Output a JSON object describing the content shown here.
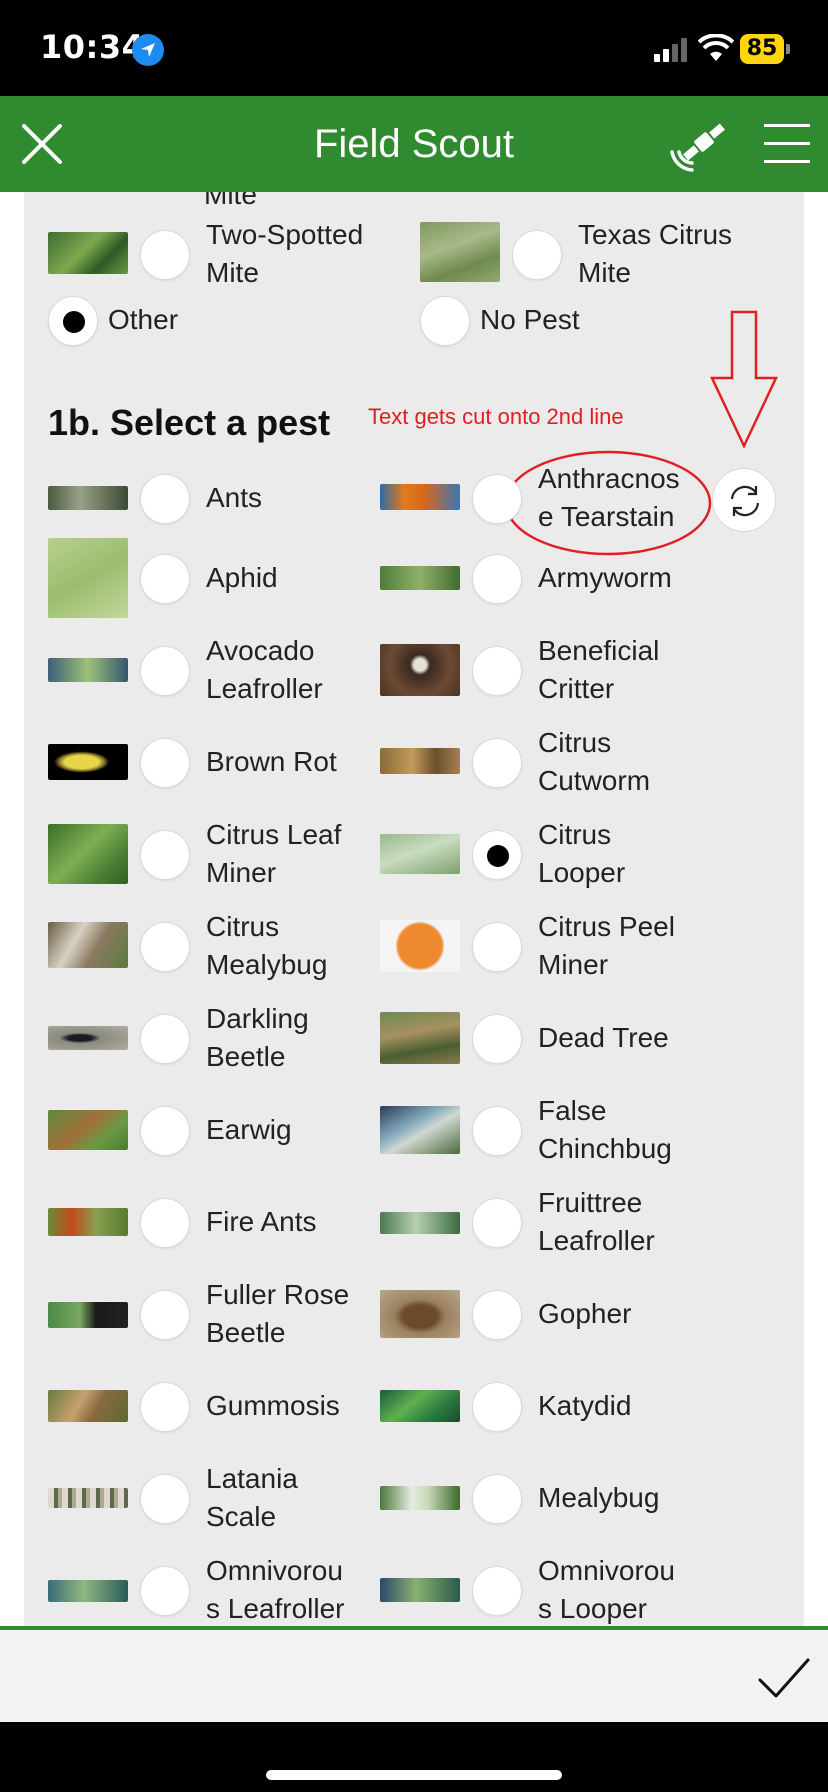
{
  "status_bar": {
    "time": "10:34",
    "battery_level": "85",
    "location_icon": "location-arrow-icon",
    "signal_icon": "cellular-signal-icon",
    "wifi_icon": "wifi-icon",
    "battery_icon": "battery-icon"
  },
  "header": {
    "title": "Field Scout",
    "close_icon": "close-icon",
    "gps_icon": "satellite-gps-icon",
    "menu_icon": "hamburger-menu-icon",
    "background_color": "#2f8a30"
  },
  "section_1a": {
    "clipped_labels": [
      "Mite",
      ""
    ],
    "options": [
      {
        "label_lines": [
          "Two-Spotted",
          "Mite"
        ],
        "checked": false,
        "has_image": true
      },
      {
        "label_lines": [
          "Texas Citrus",
          "Mite"
        ],
        "checked": false,
        "has_image": true
      },
      {
        "label_lines": [
          "Other"
        ],
        "checked": true,
        "has_image": false
      },
      {
        "label_lines": [
          "No Pest"
        ],
        "checked": false,
        "has_image": false
      }
    ]
  },
  "section_1b": {
    "title": "1b. Select a pest",
    "annotation": "Text gets cut onto 2nd line",
    "annotation_color": "#e02020",
    "refresh_icon": "refresh-icon",
    "options": [
      {
        "label_lines": [
          "Ants"
        ],
        "checked": false
      },
      {
        "label_lines": [
          "Anthracnos",
          "e Tearstain"
        ],
        "checked": false
      },
      {
        "label_lines": [
          "Aphid"
        ],
        "checked": false
      },
      {
        "label_lines": [
          "Armyworm"
        ],
        "checked": false
      },
      {
        "label_lines": [
          "Avocado",
          "Leafroller"
        ],
        "checked": false
      },
      {
        "label_lines": [
          "Beneficial",
          "Critter"
        ],
        "checked": false
      },
      {
        "label_lines": [
          "Brown Rot"
        ],
        "checked": false
      },
      {
        "label_lines": [
          "Citrus",
          "Cutworm"
        ],
        "checked": false
      },
      {
        "label_lines": [
          "Citrus Leaf",
          "Miner"
        ],
        "checked": false
      },
      {
        "label_lines": [
          "Citrus",
          "Looper"
        ],
        "checked": true
      },
      {
        "label_lines": [
          "Citrus",
          "Mealybug"
        ],
        "checked": false
      },
      {
        "label_lines": [
          "Citrus Peel",
          "Miner"
        ],
        "checked": false
      },
      {
        "label_lines": [
          "Darkling",
          "Beetle"
        ],
        "checked": false
      },
      {
        "label_lines": [
          "Dead Tree"
        ],
        "checked": false
      },
      {
        "label_lines": [
          "Earwig"
        ],
        "checked": false
      },
      {
        "label_lines": [
          "False",
          "Chinchbug"
        ],
        "checked": false
      },
      {
        "label_lines": [
          "Fire Ants"
        ],
        "checked": false
      },
      {
        "label_lines": [
          "Fruittree",
          "Leafroller"
        ],
        "checked": false
      },
      {
        "label_lines": [
          "Fuller Rose",
          "Beetle"
        ],
        "checked": false
      },
      {
        "label_lines": [
          "Gopher"
        ],
        "checked": false
      },
      {
        "label_lines": [
          "Gummosis"
        ],
        "checked": false
      },
      {
        "label_lines": [
          "Katydid"
        ],
        "checked": false
      },
      {
        "label_lines": [
          "Latania",
          "Scale"
        ],
        "checked": false
      },
      {
        "label_lines": [
          "Mealybug"
        ],
        "checked": false
      },
      {
        "label_lines": [
          "Omnivorou",
          "s Leafroller"
        ],
        "checked": false
      },
      {
        "label_lines": [
          "Omnivorou",
          "s Looper"
        ],
        "checked": false
      }
    ]
  },
  "footer": {
    "submit_icon": "checkmark-icon"
  }
}
